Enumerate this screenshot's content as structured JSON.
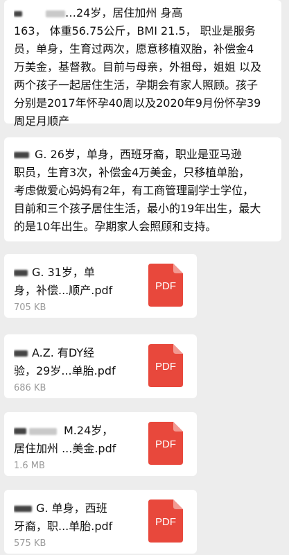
{
  "messages": [
    {
      "lines": [
        "…24岁，居住加州 身高",
        "163， 体重56.75公斤，BMI 21.5， 职业是服务",
        "员，单身，生育过两次，愿意移植双胎，补偿金4",
        "万美金，基督教。目前与母亲，外祖母，姐姐 以及",
        "两个孩子一起居住生活，孕期会有家人照顾。孩子",
        "分别是2017年怀孕40周以及2020年9月份怀孕39",
        "周足月顺产"
      ]
    },
    {
      "lines": [
        "G. 26岁，单身，西班牙裔，职业是亚马逊",
        "职员，生育3次，补偿金4万美金，只移植单胎，",
        "考虑做爱心妈妈有2年，有工商管理副学士学位，",
        "目前和三个孩子居住生活，最小的19年出生，最大",
        "的是10年出生。孕期家人会照顾和支持。"
      ]
    }
  ],
  "files": [
    {
      "name_line1": "G. 31岁，单",
      "name_line2": "身，补偿...顺产.pdf",
      "size": "705 KB",
      "icon_label": "PDF"
    },
    {
      "name_line1": "A.Z. 有DY经",
      "name_line2": "验，29岁...单胎.pdf",
      "size": "686 KB",
      "icon_label": "PDF"
    },
    {
      "name_line1": "M.24岁，",
      "name_line2": "居住加州 ...美金.pdf",
      "size": "1.6 MB",
      "icon_label": "PDF"
    },
    {
      "name_line1": "G. 单身，西班",
      "name_line2": "牙裔，职...单胎.pdf",
      "size": "575 KB",
      "icon_label": "PDF"
    }
  ],
  "colors": {
    "pdf_red": "#e8483c",
    "pdf_fold": "#f29a92",
    "bubble_bg": "#ffffff",
    "page_bg": "#ededed"
  },
  "icons": {
    "file": "pdf-file-icon"
  }
}
